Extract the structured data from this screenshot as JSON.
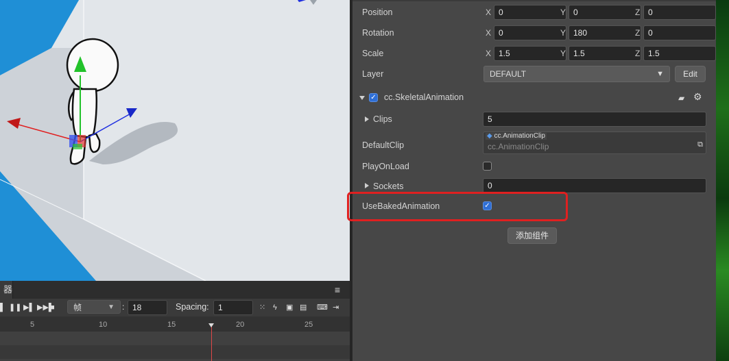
{
  "animation_panel": {
    "tab_label": "器",
    "menu_icon": "hamburger-icon",
    "toolbar": {
      "unit_select": "帧",
      "frame_label": ":",
      "frame_value": "18",
      "spacing_label": "Spacing:",
      "spacing_value": "1"
    },
    "ruler_ticks": [
      "5",
      "10",
      "15",
      "20",
      "25"
    ]
  },
  "inspector": {
    "transform": {
      "position": {
        "label": "Position",
        "x": "0",
        "y": "0",
        "z": "0"
      },
      "rotation": {
        "label": "Rotation",
        "x": "0",
        "y": "180",
        "z": "0"
      },
      "scale": {
        "label": "Scale",
        "x": "1.5",
        "y": "1.5",
        "z": "1.5"
      },
      "axis_x": "X",
      "axis_y": "Y",
      "axis_z": "Z"
    },
    "layer": {
      "label": "Layer",
      "value": "DEFAULT",
      "edit_label": "Edit"
    },
    "component": {
      "name": "cc.SkeletalAnimation",
      "enabled": true,
      "clips": {
        "label": "Clips",
        "value": "5"
      },
      "default_clip": {
        "label": "DefaultClip",
        "type_tag": "cc.AnimationClip",
        "placeholder": "cc.AnimationClip"
      },
      "play_on_load": {
        "label": "PlayOnLoad",
        "checked": false
      },
      "sockets": {
        "label": "Sockets",
        "value": "0"
      },
      "use_baked_animation": {
        "label": "UseBakedAnimation",
        "checked": true
      }
    },
    "add_component_label": "添加组件"
  },
  "colors": {
    "accent": "#2f6fd6",
    "highlight": "#e02020",
    "playhead": "#e04848"
  }
}
